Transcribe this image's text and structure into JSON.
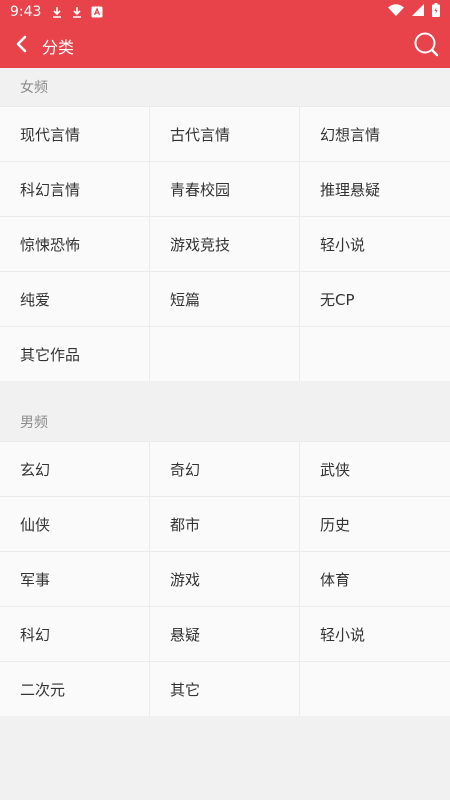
{
  "status_bar": {
    "time": "9:43",
    "left_icons": [
      "download-icon",
      "download-icon",
      "app-icon"
    ],
    "right_icons": [
      "wifi-icon",
      "cellular-icon",
      "battery-icon"
    ]
  },
  "app_bar": {
    "title": "分类",
    "background": "#e8434a"
  },
  "sections": [
    {
      "title": "女频",
      "rows": [
        [
          "现代言情",
          "古代言情",
          "幻想言情"
        ],
        [
          "科幻言情",
          "青春校园",
          "推理悬疑"
        ],
        [
          "惊悚恐怖",
          "游戏竞技",
          "轻小说"
        ],
        [
          "纯爱",
          "短篇",
          "无CP"
        ],
        [
          "其它作品",
          "",
          ""
        ]
      ]
    },
    {
      "title": "男频",
      "rows": [
        [
          "玄幻",
          "奇幻",
          "武侠"
        ],
        [
          "仙侠",
          "都市",
          "历史"
        ],
        [
          "军事",
          "游戏",
          "体育"
        ],
        [
          "科幻",
          "悬疑",
          "轻小说"
        ],
        [
          "二次元",
          "其它",
          ""
        ]
      ]
    }
  ]
}
